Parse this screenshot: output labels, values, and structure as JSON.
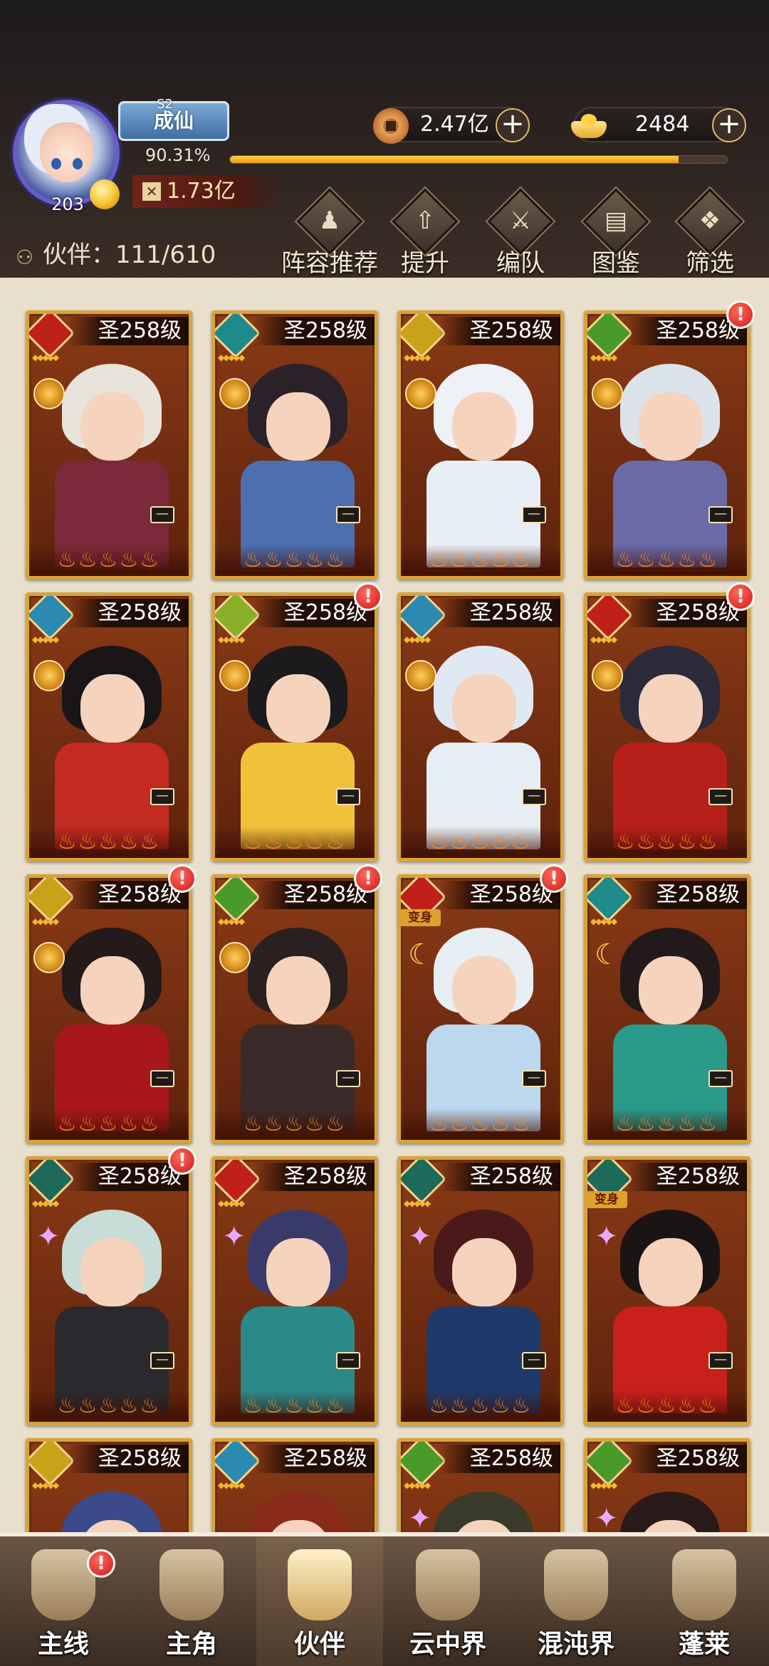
{
  "header": {
    "rank_season": "S2",
    "rank_title": "成仙",
    "exp_percent_text": "90.31%",
    "exp_fraction": 0.9031,
    "player_level": "203",
    "combat_power": "1.73亿",
    "copper": "2.47亿",
    "ingot": "2484"
  },
  "partner_count_label": "伙伴：111/610",
  "toolbar": [
    {
      "label": "阵容推荐",
      "icon": "lineup-recommend-icon"
    },
    {
      "label": "提升",
      "icon": "upgrade-icon"
    },
    {
      "label": "编队",
      "icon": "formation-icon"
    },
    {
      "label": "图鉴",
      "icon": "codex-icon"
    },
    {
      "label": "筛选",
      "icon": "filter-icon"
    }
  ],
  "cards": [
    {
      "level": "圣258级",
      "faction_color": "#c0201a",
      "hair": "#e9e3dd",
      "outfit": "#7a2a3a",
      "alert": false,
      "transform": false,
      "medal": "gold"
    },
    {
      "level": "圣258级",
      "faction_color": "#1e8a8a",
      "hair": "#2a2228",
      "outfit": "#4c6fb0",
      "alert": false,
      "transform": false,
      "medal": "gold"
    },
    {
      "level": "圣258级",
      "faction_color": "#c9a21a",
      "hair": "#eef1f6",
      "outfit": "#e8eef6",
      "alert": false,
      "transform": false,
      "medal": "gold"
    },
    {
      "level": "圣258级",
      "faction_color": "#4a9a2a",
      "hair": "#dce3ea",
      "outfit": "#6a6aa8",
      "alert": true,
      "transform": false,
      "medal": "gold"
    },
    {
      "level": "圣258级",
      "faction_color": "#2a8ab0",
      "hair": "#1a1618",
      "outfit": "#c32a22",
      "alert": false,
      "transform": false,
      "medal": "gold"
    },
    {
      "level": "圣258级",
      "faction_color": "#8ab02a",
      "hair": "#1c1a1c",
      "outfit": "#f0c23a",
      "alert": true,
      "transform": false,
      "medal": "gold"
    },
    {
      "level": "圣258级",
      "faction_color": "#2a8ab0",
      "hair": "#dfe9f3",
      "outfit": "#e6eef4",
      "alert": false,
      "transform": false,
      "medal": "gold"
    },
    {
      "level": "圣258级",
      "faction_color": "#c0201a",
      "hair": "#2a2a3a",
      "outfit": "#b7201a",
      "alert": true,
      "transform": false,
      "medal": "gold"
    },
    {
      "level": "圣258级",
      "faction_color": "#c9a21a",
      "hair": "#241a1a",
      "outfit": "#a8181a",
      "alert": true,
      "transform": false,
      "medal": "gold"
    },
    {
      "level": "圣258级",
      "faction_color": "#4a9a2a",
      "hair": "#2a2020",
      "outfit": "#3a2a2a",
      "alert": true,
      "transform": false,
      "medal": "gold"
    },
    {
      "level": "圣258级",
      "faction_color": "#c0201a",
      "hair": "#e7eef4",
      "outfit": "#bcd8ee",
      "alert": true,
      "transform": true,
      "medal": "moon"
    },
    {
      "level": "圣258级",
      "faction_color": "#1e8a8a",
      "hair": "#221a1a",
      "outfit": "#2a9a8a",
      "alert": false,
      "transform": false,
      "medal": "moon"
    },
    {
      "level": "圣258级",
      "faction_color": "#1e6a5a",
      "hair": "#c8dcd8",
      "outfit": "#2a2a2e",
      "alert": true,
      "transform": false,
      "medal": "star"
    },
    {
      "level": "圣258级",
      "faction_color": "#c0201a",
      "hair": "#3a3a6a",
      "outfit": "#2a8a8a",
      "alert": false,
      "transform": false,
      "medal": "star"
    },
    {
      "level": "圣258级",
      "faction_color": "#1e6a5a",
      "hair": "#4a1a1a",
      "outfit": "#1e3a6a",
      "alert": false,
      "transform": false,
      "medal": "star"
    },
    {
      "level": "圣258级",
      "faction_color": "#1e6a5a",
      "hair": "#1a1414",
      "outfit": "#c8201a",
      "alert": false,
      "transform": true,
      "medal": "star"
    },
    {
      "level": "圣258级",
      "faction_color": "#c9a21a",
      "hair": "#3a4a8a",
      "outfit": "#3a4a8a",
      "alert": false,
      "transform": false,
      "medal": "none"
    },
    {
      "level": "圣258级",
      "faction_color": "#2a8ab0",
      "hair": "#8a2a1a",
      "outfit": "#8a2a1a",
      "alert": false,
      "transform": false,
      "medal": "none"
    },
    {
      "level": "圣258级",
      "faction_color": "#4a9a2a",
      "hair": "#3a3a2a",
      "outfit": "#3a3a2a",
      "alert": false,
      "transform": false,
      "medal": "star"
    },
    {
      "level": "圣258级",
      "faction_color": "#4a9a2a",
      "hair": "#2a1a1a",
      "outfit": "#2a1a1a",
      "alert": false,
      "transform": false,
      "medal": "star"
    }
  ],
  "transform_badge": "变身",
  "alert_glyph": "!",
  "equip_glyph": "—",
  "flames": "♨♨♨♨♨",
  "rank_stars": "◆◆◆◆◆",
  "bottom_nav": [
    {
      "label": "主线",
      "icon": "main-quest-icon",
      "active": false,
      "alert": true
    },
    {
      "label": "主角",
      "icon": "protagonist-icon",
      "active": false,
      "alert": false
    },
    {
      "label": "伙伴",
      "icon": "partner-icon",
      "active": true,
      "alert": false
    },
    {
      "label": "云中界",
      "icon": "cloud-realm-icon",
      "active": false,
      "alert": false
    },
    {
      "label": "混沌界",
      "icon": "chaos-realm-icon",
      "active": false,
      "alert": false
    },
    {
      "label": "蓬莱",
      "icon": "penglai-icon",
      "active": false,
      "alert": false
    }
  ]
}
